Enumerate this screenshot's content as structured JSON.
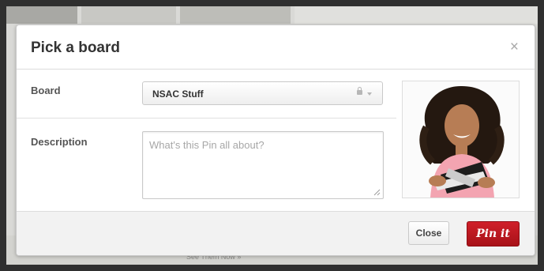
{
  "dialog": {
    "title": "Pick a board",
    "close_glyph": "×"
  },
  "form": {
    "board_label": "Board",
    "board_value": "NSAC Stuff",
    "description_label": "Description",
    "description_placeholder": "What's this Pin all about?"
  },
  "footer": {
    "close_label": "Close",
    "pin_label": "Pin it"
  },
  "background": {
    "partial_text": "See Them Now »"
  },
  "icons": {
    "lock": "lock-icon",
    "chevron": "chevron-down-icon",
    "resize_grip": "resize-grip-icon"
  },
  "colors": {
    "pin_button": "#bd1b23",
    "overlay": "#d9d9d6"
  }
}
